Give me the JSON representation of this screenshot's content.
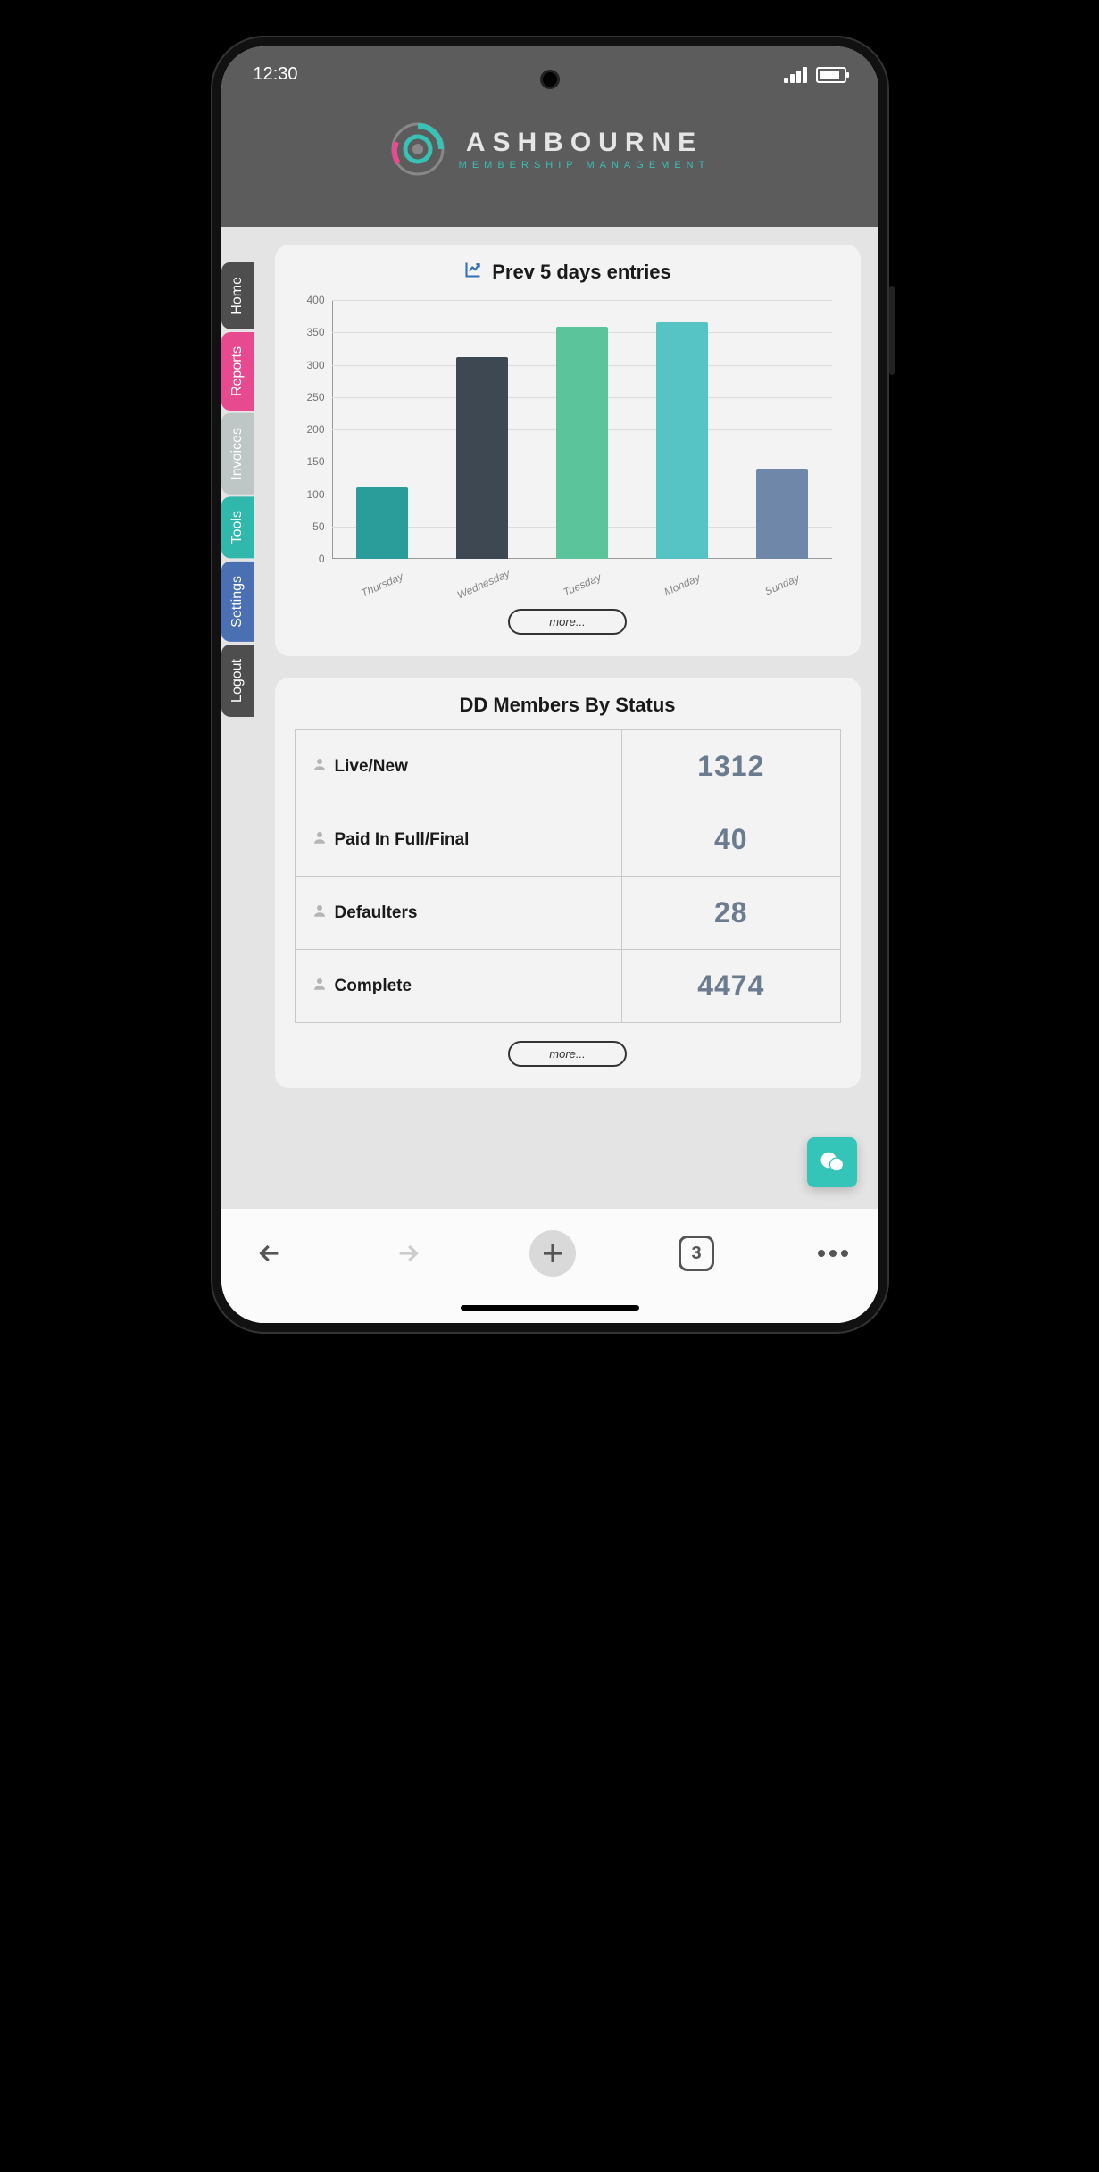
{
  "status_bar": {
    "time": "12:30"
  },
  "brand": {
    "name": "ASHBOURNE",
    "tagline": "MEMBERSHIP MANAGEMENT"
  },
  "sidebar": {
    "items": [
      {
        "label": "Home",
        "color": "#4e4e4e"
      },
      {
        "label": "Reports",
        "color": "#e84a8f"
      },
      {
        "label": "Invoices",
        "color": "#bfc6c6"
      },
      {
        "label": "Tools",
        "color": "#2fb8ab"
      },
      {
        "label": "Settings",
        "color": "#4a6fb3"
      },
      {
        "label": "Logout",
        "color": "#4e4e4e"
      }
    ]
  },
  "cards": {
    "entries": {
      "title": "Prev 5 days entries",
      "more": "more..."
    },
    "dd_status": {
      "title": "DD Members By Status",
      "rows": [
        {
          "label": "Live/New",
          "value": "1312"
        },
        {
          "label": "Paid In Full/Final",
          "value": "40"
        },
        {
          "label": "Defaulters",
          "value": "28"
        },
        {
          "label": "Complete",
          "value": "4474"
        }
      ],
      "more": "more..."
    }
  },
  "browser": {
    "tab_count": "3"
  },
  "chart_data": {
    "type": "bar",
    "title": "Prev 5 days entries",
    "categories": [
      "Thursday",
      "Wednesday",
      "Tuesday",
      "Monday",
      "Sunday"
    ],
    "values": [
      110,
      312,
      358,
      365,
      140
    ],
    "colors": [
      "#2a9d9a",
      "#3d4852",
      "#5cc49b",
      "#56c4c4",
      "#6f87a8"
    ],
    "ylim": [
      0,
      400
    ],
    "y_ticks": [
      0,
      50,
      100,
      150,
      200,
      250,
      300,
      350,
      400
    ],
    "xlabel": "",
    "ylabel": ""
  }
}
